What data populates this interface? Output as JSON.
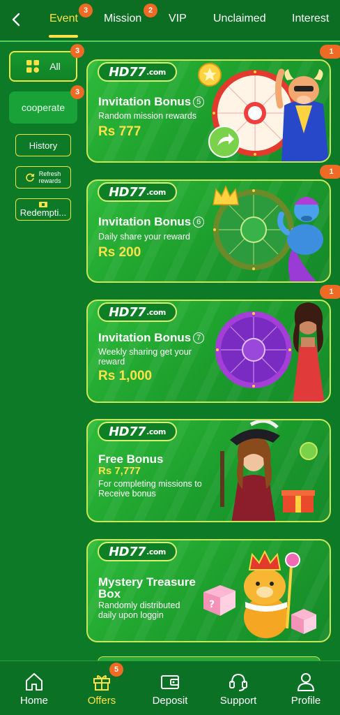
{
  "header": {
    "tabs": [
      {
        "label": "Event",
        "badge": "3",
        "active": true
      },
      {
        "label": "Mission",
        "badge": "2"
      },
      {
        "label": "VIP"
      },
      {
        "label": "Unclaimed"
      },
      {
        "label": "Interest"
      }
    ]
  },
  "sidebar": {
    "all": {
      "label": "All",
      "badge": "3"
    },
    "cooperate": {
      "label": "cooperate",
      "badge": "3"
    },
    "history": "History",
    "refresh": {
      "line1": "Refresh",
      "line2": "rewards"
    },
    "redemption": "Redempti..."
  },
  "cards": [
    {
      "logo": "HD77",
      "logo_ext": ".com",
      "title": "Invitation Bonus",
      "num": "5",
      "subtitle": "Random mission rewards",
      "amount": "Rs 777",
      "badge": "1"
    },
    {
      "logo": "HD77",
      "logo_ext": ".com",
      "title": "Invitation Bonus",
      "num": "6",
      "subtitle": "Daily share your reward",
      "amount": "Rs 200",
      "badge": "1"
    },
    {
      "logo": "HD77",
      "logo_ext": ".com",
      "title": "Invitation Bonus",
      "num": "7",
      "subtitle_line1": "Weekly sharing get your",
      "subtitle_line2": "reward",
      "amount": "Rs 1,000",
      "badge": "1"
    },
    {
      "logo": "HD77",
      "logo_ext": ".com",
      "title": "Free Bonus",
      "amount": "Rs 7,777",
      "subtitle_line1": "For completing missions to",
      "subtitle_line2": "Receive bonus"
    },
    {
      "logo": "HD77",
      "logo_ext": ".com",
      "title_line1": "Mystery Treasure",
      "title_line2": "Box",
      "subtitle_line1": "Randomly distributed",
      "subtitle_line2": "daily upon loggin"
    }
  ],
  "bottom_nav": [
    {
      "label": "Home",
      "icon": "home-icon"
    },
    {
      "label": "Offers",
      "icon": "gift-icon",
      "badge": "5",
      "active": true
    },
    {
      "label": "Deposit",
      "icon": "wallet-icon"
    },
    {
      "label": "Support",
      "icon": "headset-icon"
    },
    {
      "label": "Profile",
      "icon": "user-icon"
    }
  ],
  "colors": {
    "accent": "#ffe24a",
    "badge": "#ef6a24",
    "bg": "#0d7a28"
  }
}
